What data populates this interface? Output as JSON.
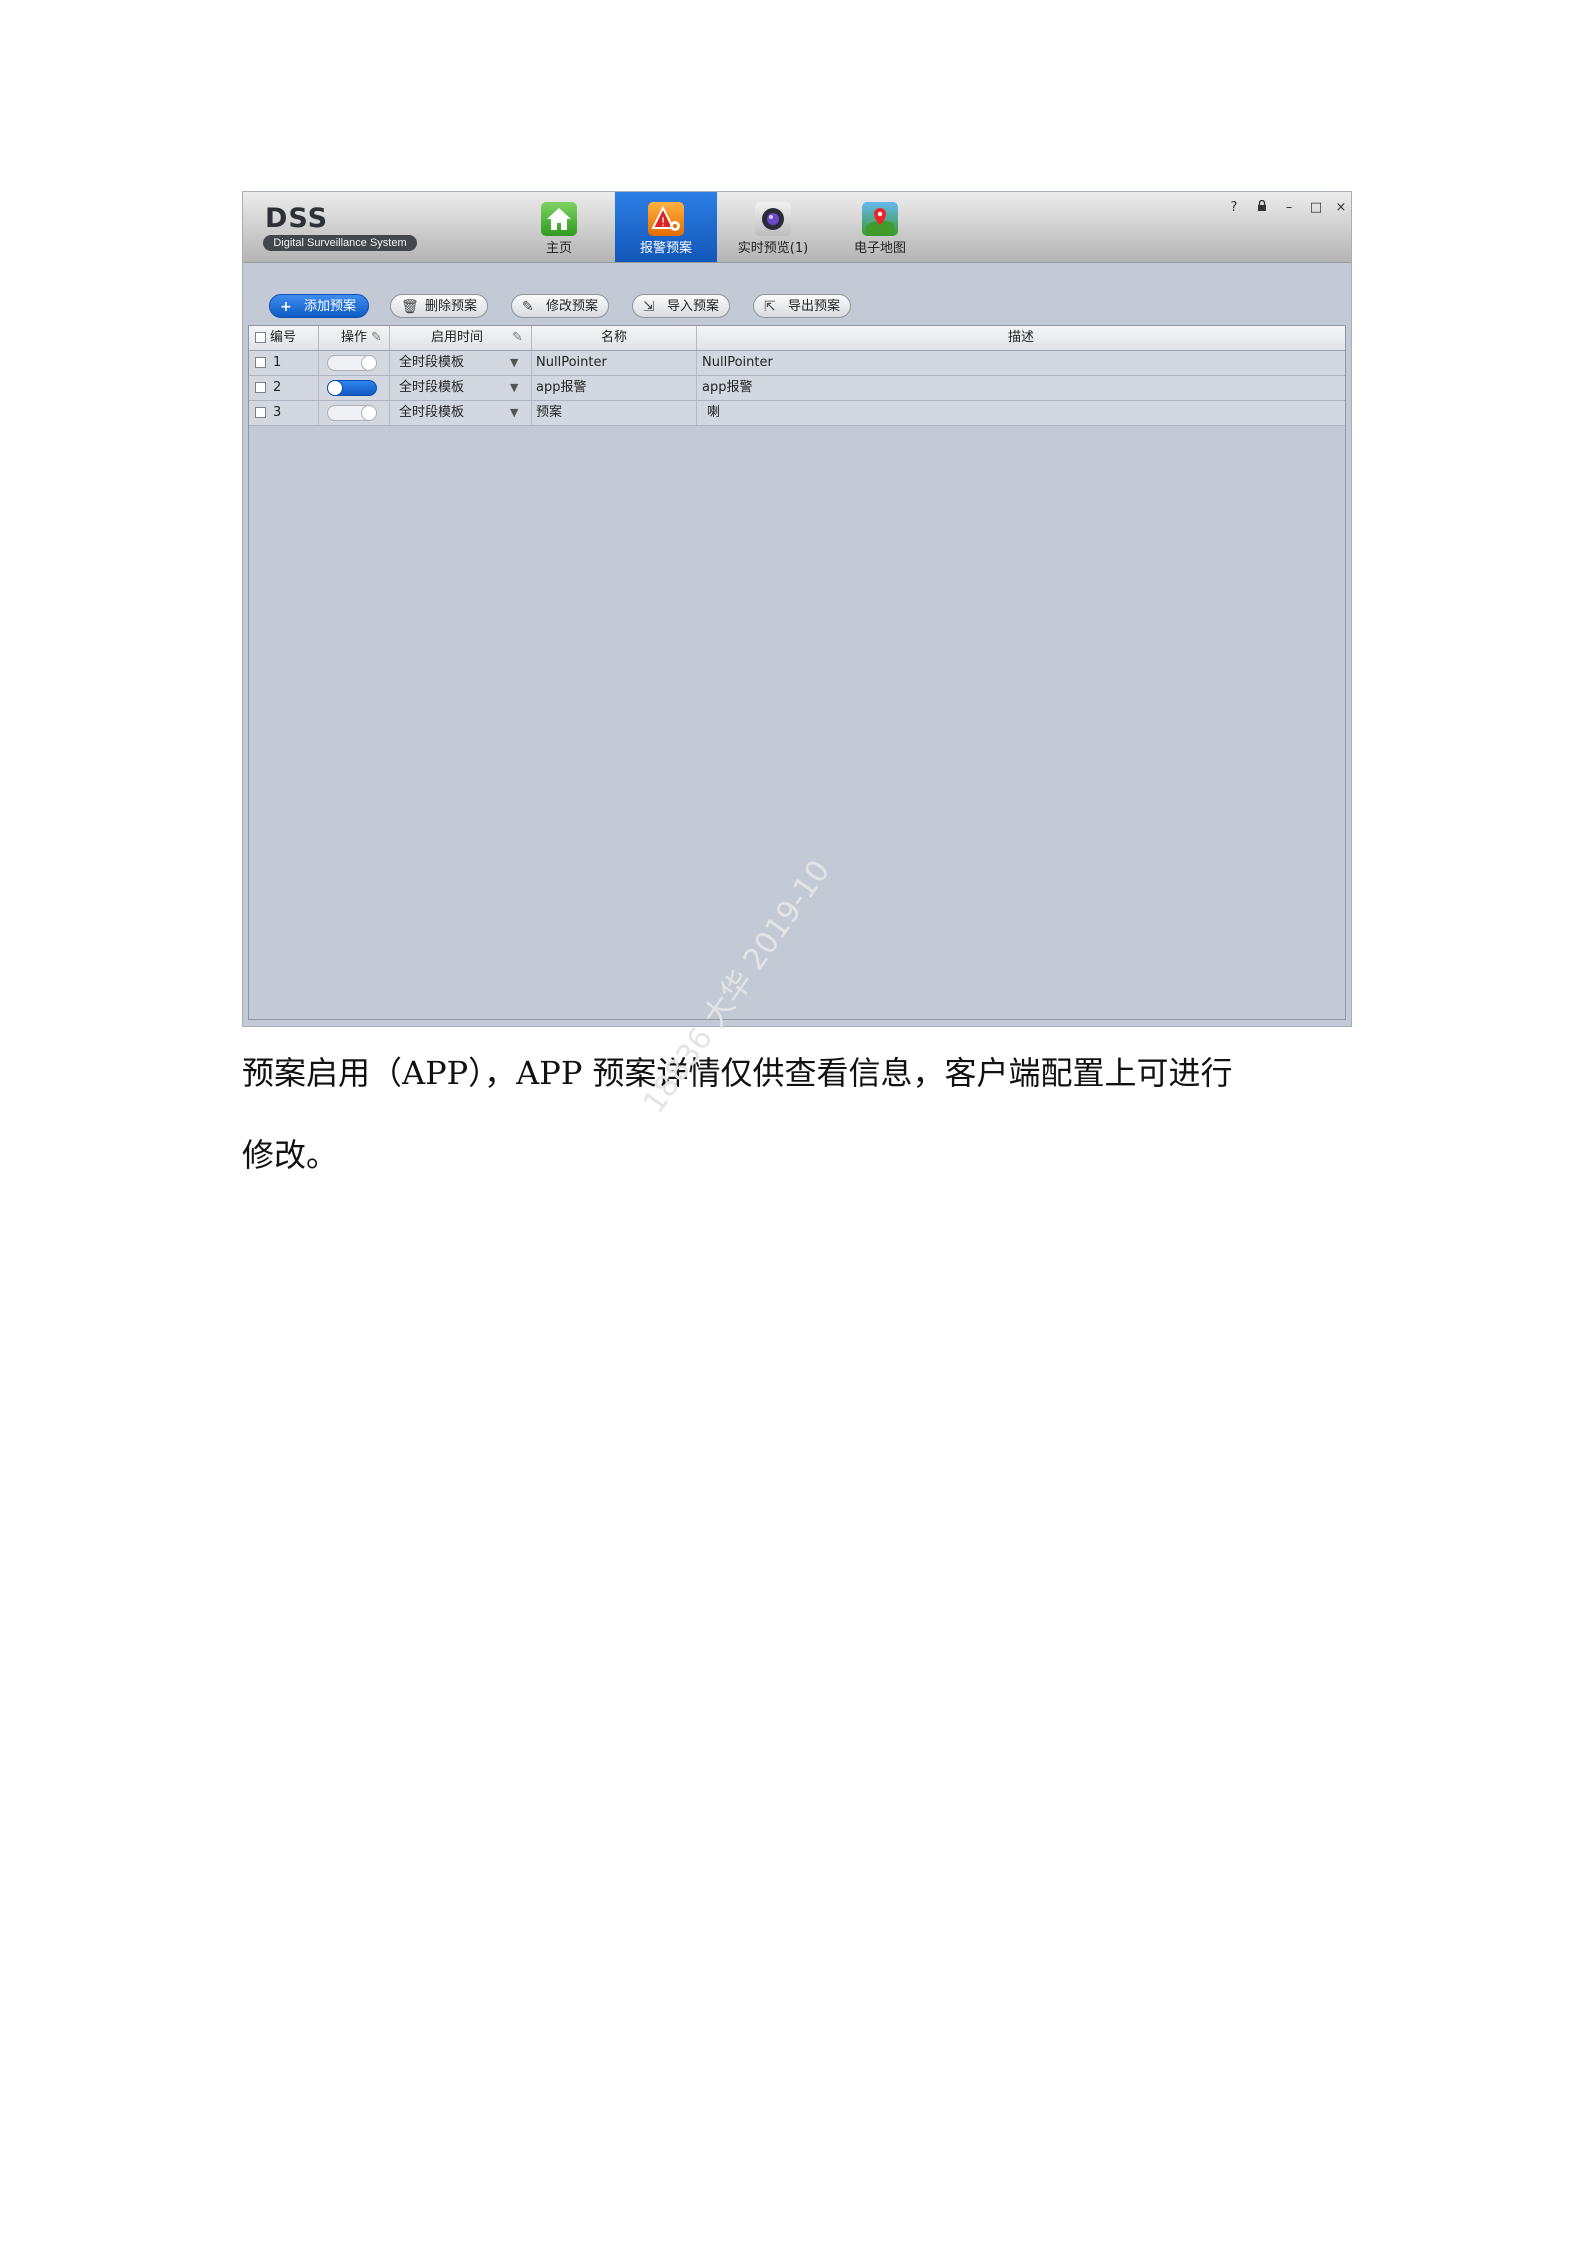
{
  "app": {
    "logo": "DSS",
    "subtitle": "Digital Surveillance System"
  },
  "nav": [
    {
      "label": "主页",
      "icon": "home-icon",
      "active": false
    },
    {
      "label": "报警预案",
      "icon": "alarm-plan-icon",
      "active": true
    },
    {
      "label": "实时预览(1)",
      "icon": "camera-icon",
      "active": false
    },
    {
      "label": "电子地图",
      "icon": "map-icon",
      "active": false
    }
  ],
  "window_controls": {
    "help": "?",
    "lock": "🔒",
    "minimize": "–",
    "maximize": "□",
    "close": "×"
  },
  "toolbar": {
    "add": "添加预案",
    "delete": "删除预案",
    "edit": "修改预案",
    "import": "导入预案",
    "export": "导出预案"
  },
  "table": {
    "headers": {
      "id": "编号",
      "op": "操作",
      "time": "启用时间",
      "name": "名称",
      "desc": "描述"
    },
    "rows": [
      {
        "id": "1",
        "enabled": false,
        "time": "全时段模板",
        "name": "NullPointer",
        "desc": "NullPointer"
      },
      {
        "id": "2",
        "enabled": true,
        "time": "全时段模板",
        "name": "app报警",
        "desc": "app报警"
      },
      {
        "id": "3",
        "enabled": false,
        "time": "全时段模板",
        "name": "预案",
        "desc": "喇"
      }
    ]
  },
  "caption": {
    "line1": "预案启用（APP），APP 预案详情仅供查看信息，客户端配置上可进行",
    "line2": "修改。"
  },
  "watermark": "18836 大华 2019-10"
}
